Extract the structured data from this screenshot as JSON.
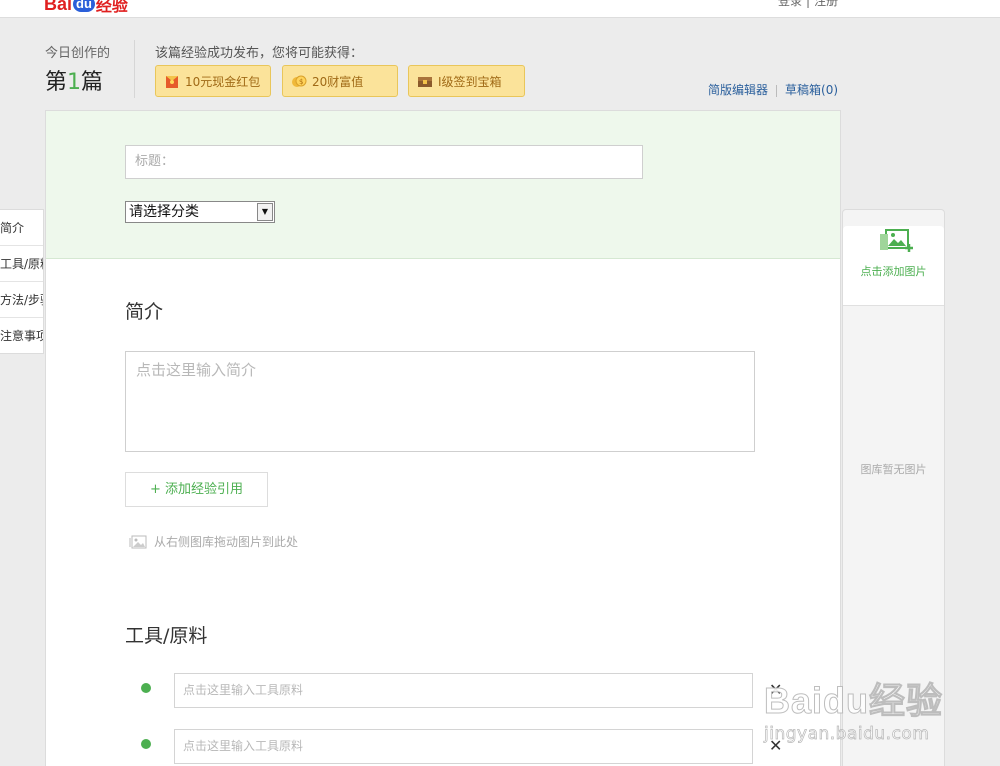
{
  "header": {
    "logo": {
      "part1": "Bai",
      "part2": "du",
      "part3": "经验"
    },
    "links": [
      "登录",
      "注册"
    ]
  },
  "stats": {
    "label": "今日创作的",
    "count_prefix": "第",
    "count_num": "1",
    "count_suffix": "篇"
  },
  "rewards": {
    "title": "该篇经验成功发布，您将可能获得：",
    "items": [
      "10元现金红包",
      "20财富值",
      "I级签到宝箱"
    ]
  },
  "editor_links": {
    "simple_editor": "简版编辑器",
    "drafts": "草稿箱(0)"
  },
  "form": {
    "title_placeholder": "标题：",
    "category_selected": "请选择分类",
    "summary_heading": "简介",
    "summary_placeholder": "点击这里输入简介",
    "add_reference": "+ 添加经验引用",
    "drag_hint": "从右侧图库拖动图片到此处",
    "tools_heading": "工具/原料",
    "tool_placeholder": "点击这里输入工具原料"
  },
  "left_nav": {
    "items": [
      "简介",
      "工具/原料",
      "方法/步骤",
      "注意事项"
    ]
  },
  "gallery": {
    "add_label": "点击添加图片",
    "empty_text": "图库暂无图片"
  },
  "watermark": {
    "brand": "Baidu经验",
    "url": "jingyan.baidu.com"
  },
  "colors": {
    "accent_green": "#4caf50",
    "reward_bg": "#fbe39a",
    "link_blue": "#2a5f9c"
  }
}
